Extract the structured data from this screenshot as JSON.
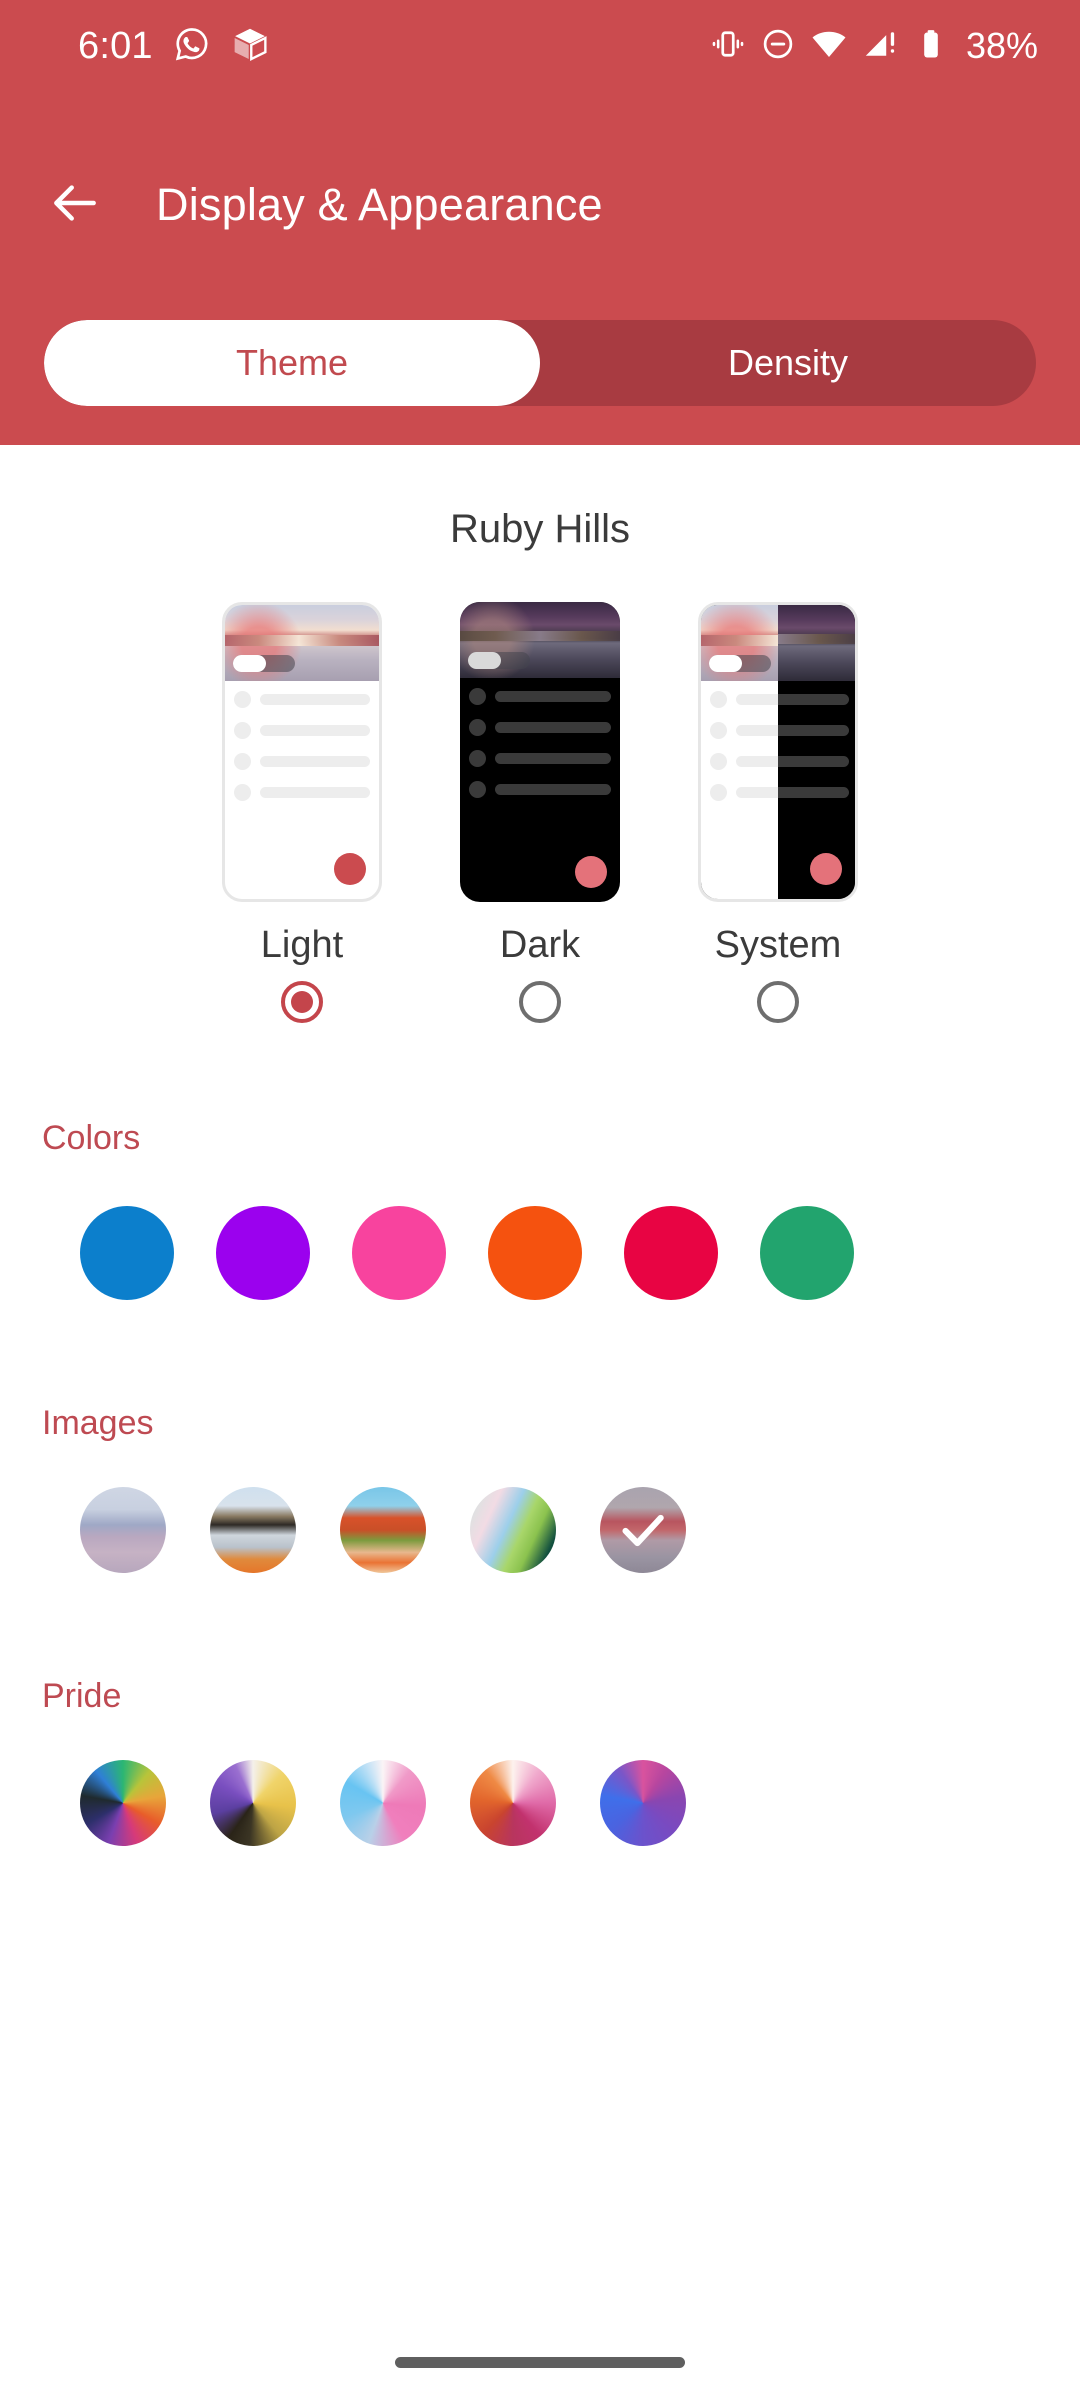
{
  "status_bar": {
    "time": "6:01",
    "battery_percent": "38%",
    "left_icons": [
      "whatsapp-icon",
      "package-icon"
    ],
    "right_icons": [
      "vibrate-icon",
      "do-not-disturb-icon",
      "wifi-icon",
      "cellular-signal-icon",
      "battery-icon"
    ]
  },
  "app_bar": {
    "back_label": "back-arrow-icon",
    "title": "Display & Appearance"
  },
  "tabs": [
    {
      "label": "Theme",
      "active": true
    },
    {
      "label": "Density",
      "active": false
    }
  ],
  "theme": {
    "palette_name": "Ruby Hills",
    "options": [
      {
        "label": "Light",
        "selected": true
      },
      {
        "label": "Dark",
        "selected": false
      },
      {
        "label": "System",
        "selected": false
      }
    ]
  },
  "sections": {
    "colors": {
      "title": "Colors",
      "swatches": [
        {
          "name": "blue",
          "hex": "#0C7FCC"
        },
        {
          "name": "purple",
          "hex": "#9B01EE"
        },
        {
          "name": "pink",
          "hex": "#F8439E"
        },
        {
          "name": "orange",
          "hex": "#F5520F"
        },
        {
          "name": "crimson",
          "hex": "#E80443"
        },
        {
          "name": "green",
          "hex": "#22A46E"
        }
      ]
    },
    "images": {
      "title": "Images",
      "thumbs": [
        {
          "name": "mountain-mist",
          "selected": false
        },
        {
          "name": "desert-ridge",
          "selected": false
        },
        {
          "name": "canyon-cactus",
          "selected": false
        },
        {
          "name": "leaf-pastel",
          "selected": false
        },
        {
          "name": "ruby-hills",
          "selected": true
        }
      ]
    },
    "pride": {
      "title": "Pride",
      "wheels": [
        {
          "name": "rainbow-wheel"
        },
        {
          "name": "nonbinary-wheel"
        },
        {
          "name": "trans-wheel"
        },
        {
          "name": "lesbian-wheel"
        },
        {
          "name": "bi-wheel"
        }
      ]
    }
  },
  "colors": {
    "header_red": "#CB4B4F",
    "tab_track": "#A83B41",
    "accent_text": "#BE4A52",
    "fab": "#CB4B4F"
  }
}
